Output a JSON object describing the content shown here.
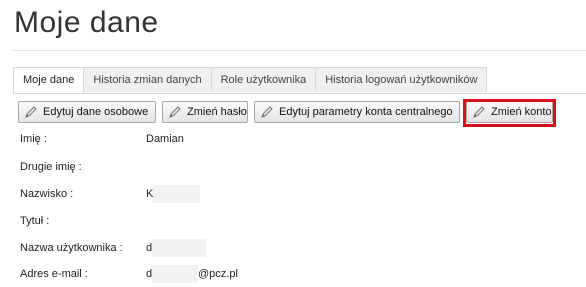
{
  "page": {
    "title": "Moje dane"
  },
  "tabs": [
    {
      "label": "Moje dane",
      "active": true
    },
    {
      "label": "Historia zmian danych",
      "active": false
    },
    {
      "label": "Role użytkownika",
      "active": false
    },
    {
      "label": "Historia logowań użytkowników",
      "active": false
    }
  ],
  "toolbar": {
    "edit_personal": "Edytuj dane osobowe",
    "change_password": "Zmień hasło",
    "edit_central": "Edytuj parametry konta centralnego",
    "change_account": "Zmień konto",
    "icon": "pencil-icon",
    "highlight_color": "#d6131b"
  },
  "fields": {
    "first_name": {
      "label": "Imię :",
      "value": "Damian"
    },
    "middle_name": {
      "label": "Drugie imię :",
      "value": ""
    },
    "last_name": {
      "label": "Nazwisko :",
      "value": "K"
    },
    "title": {
      "label": "Tytuł :",
      "value": ""
    },
    "username": {
      "label": "Nazwa użytkownika :",
      "value": "d"
    },
    "email": {
      "label": "Adres e-mail :",
      "value": "d",
      "value_suffix": "@pcz.pl"
    }
  }
}
